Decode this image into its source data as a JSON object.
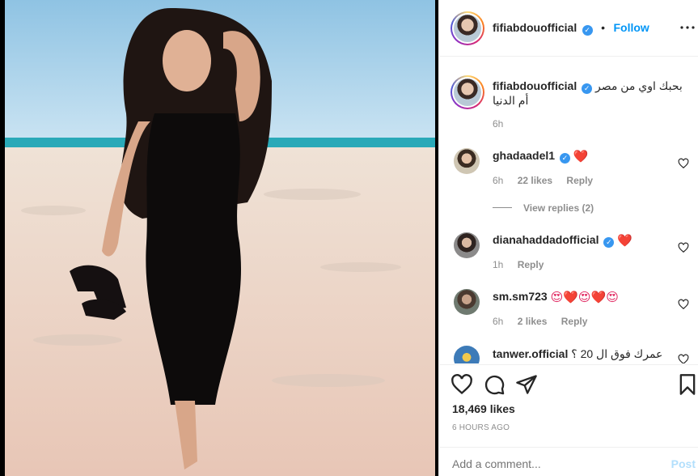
{
  "post": {
    "username": "fifiabdouofficial",
    "follow_label": "Follow",
    "caption_line1": "بحبك اوي من مصر",
    "caption_line2": "أم الدنيا",
    "caption_time": "6h",
    "likes": "18,469 likes",
    "ago": "6 HOURS AGO"
  },
  "comments": [
    {
      "username": "ghadaadel1",
      "text": "❤️",
      "time": "6h",
      "likes": "22 likes",
      "reply": "Reply",
      "view_replies": "View replies (2)"
    },
    {
      "username": "dianahaddadofficial",
      "text": "❤️",
      "time": "1h",
      "reply": "Reply"
    },
    {
      "username": "sm.sm723",
      "text": "😍❤️😍❤️😍",
      "time": "6h",
      "likes": "2 likes",
      "reply": "Reply"
    },
    {
      "username": "tanwer.official",
      "text": "عمرك فوق ال 20 ؟"
    }
  ],
  "add_comment": {
    "placeholder": "Add a comment...",
    "post_label": "Post"
  },
  "icons": [
    "verified-badge-icon",
    "heart-icon",
    "comment-icon",
    "share-icon",
    "bookmark-icon",
    "more-icon"
  ],
  "colors": {
    "accent": "#0095f6",
    "verified": "#3897f0",
    "heart": "#ed4956",
    "muted": "#8e8e8e"
  }
}
